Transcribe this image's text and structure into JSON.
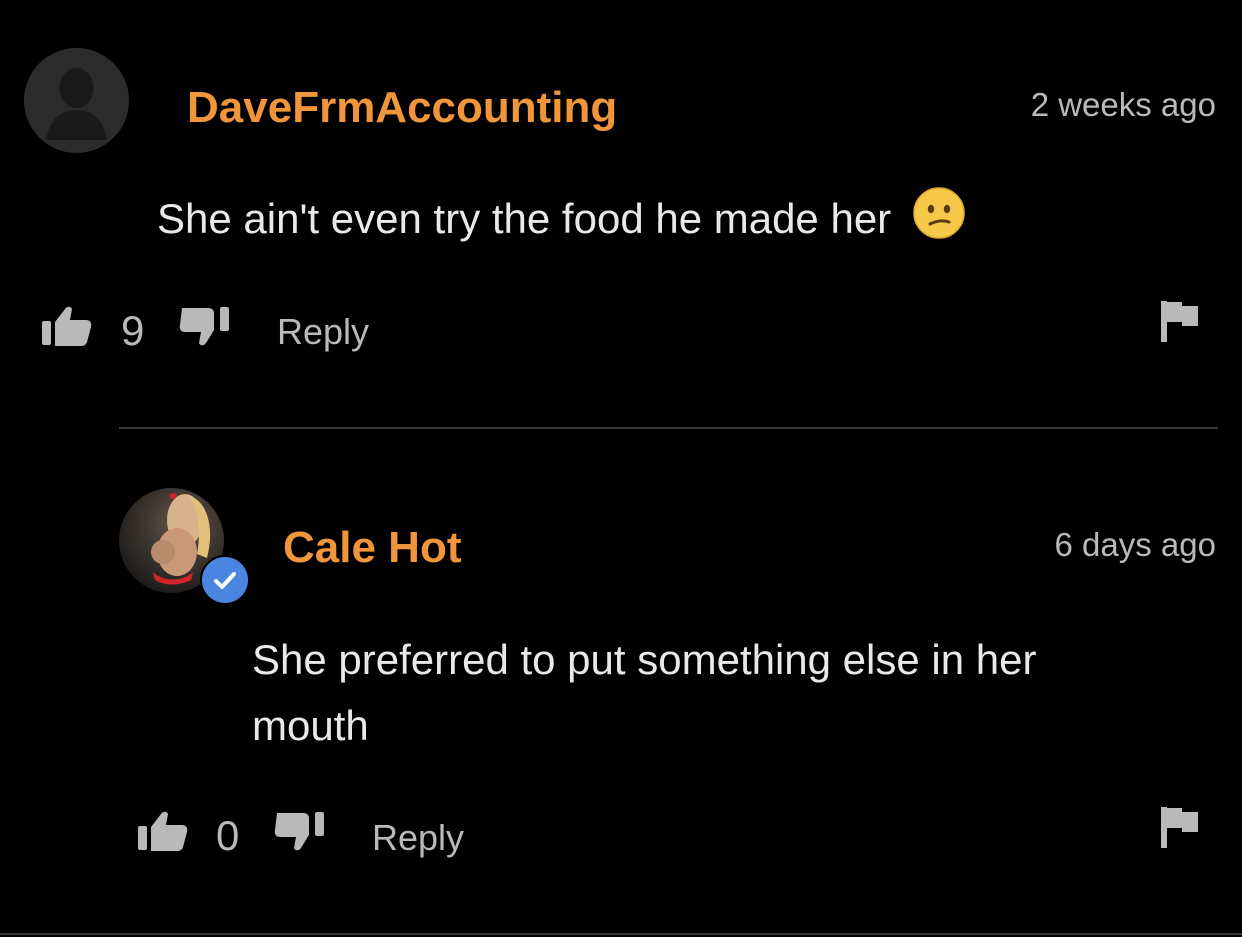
{
  "comments": [
    {
      "username": "DaveFrmAccounting",
      "timestamp": "2 weeks ago",
      "text": "She ain't even try the food he made her",
      "emoji_icon": "confused-face-emoji",
      "likes": "9",
      "reply_label": "Reply",
      "avatar_icon": "default-user-silhouette"
    },
    {
      "username": "Cale Hot",
      "timestamp": "6 days ago",
      "text": "She preferred to put something else in her mouth",
      "likes": "0",
      "reply_label": "Reply",
      "verified_icon": "verified-check-icon"
    }
  ],
  "colors": {
    "background": "#000000",
    "username": "#f0953a",
    "text": "#e9e9e9",
    "muted": "#b9b9b9",
    "divider": "#3a3a3a",
    "verified": "#4a86e0"
  }
}
